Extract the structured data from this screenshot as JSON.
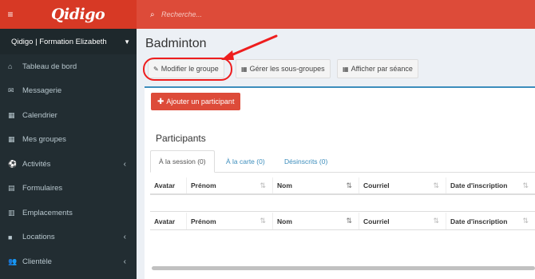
{
  "app": {
    "logo": "Qidigo"
  },
  "topbar": {
    "search_placeholder": "Recherche..."
  },
  "sidebar": {
    "org_name": "Qidigo | Formation Elizabeth",
    "items": [
      {
        "label": "Tableau de bord",
        "icon": "home-icon"
      },
      {
        "label": "Messagerie",
        "icon": "envelope-icon"
      },
      {
        "label": "Calendrier",
        "icon": "calendar-icon"
      },
      {
        "label": "Mes groupes",
        "icon": "calendar-icon"
      },
      {
        "label": "Activités",
        "icon": "soccer-ball-icon",
        "submenu": true
      },
      {
        "label": "Formulaires",
        "icon": "document-icon"
      },
      {
        "label": "Emplacements",
        "icon": "building-icon"
      },
      {
        "label": "Locations",
        "icon": "briefcase-icon",
        "submenu": true
      },
      {
        "label": "Clientèle",
        "icon": "users-icon",
        "submenu": true
      }
    ]
  },
  "page": {
    "title": "Badminton",
    "toolbar": {
      "edit_group": "Modifier le groupe",
      "subgroups": "Gérer les sous-groupes",
      "by_session": "Afficher par séance"
    },
    "add_participant": "Ajouter un participant",
    "section_title": "Participants",
    "tabs": [
      "À la session (0)",
      "À la carte (0)",
      "Désinscrits (0)"
    ],
    "table": {
      "columns": [
        "Avatar",
        "Prénom",
        "Nom",
        "Courriel",
        "Date d'inscription"
      ]
    }
  },
  "colors": {
    "brand_red": "#dd4b39",
    "sidebar_bg": "#222d32",
    "annotation_red": "#ee1e1e",
    "link_blue": "#3c8dbc"
  }
}
